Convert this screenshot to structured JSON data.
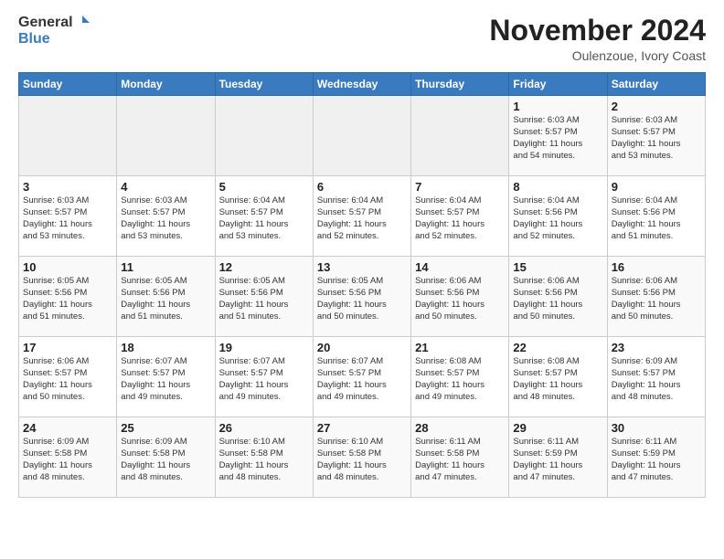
{
  "header": {
    "logo_general": "General",
    "logo_blue": "Blue",
    "month_title": "November 2024",
    "location": "Oulenzoue, Ivory Coast"
  },
  "days_of_week": [
    "Sunday",
    "Monday",
    "Tuesday",
    "Wednesday",
    "Thursday",
    "Friday",
    "Saturday"
  ],
  "weeks": [
    [
      {
        "day": "",
        "info": ""
      },
      {
        "day": "",
        "info": ""
      },
      {
        "day": "",
        "info": ""
      },
      {
        "day": "",
        "info": ""
      },
      {
        "day": "",
        "info": ""
      },
      {
        "day": "1",
        "info": "Sunrise: 6:03 AM\nSunset: 5:57 PM\nDaylight: 11 hours\nand 54 minutes."
      },
      {
        "day": "2",
        "info": "Sunrise: 6:03 AM\nSunset: 5:57 PM\nDaylight: 11 hours\nand 53 minutes."
      }
    ],
    [
      {
        "day": "3",
        "info": "Sunrise: 6:03 AM\nSunset: 5:57 PM\nDaylight: 11 hours\nand 53 minutes."
      },
      {
        "day": "4",
        "info": "Sunrise: 6:03 AM\nSunset: 5:57 PM\nDaylight: 11 hours\nand 53 minutes."
      },
      {
        "day": "5",
        "info": "Sunrise: 6:04 AM\nSunset: 5:57 PM\nDaylight: 11 hours\nand 53 minutes."
      },
      {
        "day": "6",
        "info": "Sunrise: 6:04 AM\nSunset: 5:57 PM\nDaylight: 11 hours\nand 52 minutes."
      },
      {
        "day": "7",
        "info": "Sunrise: 6:04 AM\nSunset: 5:57 PM\nDaylight: 11 hours\nand 52 minutes."
      },
      {
        "day": "8",
        "info": "Sunrise: 6:04 AM\nSunset: 5:56 PM\nDaylight: 11 hours\nand 52 minutes."
      },
      {
        "day": "9",
        "info": "Sunrise: 6:04 AM\nSunset: 5:56 PM\nDaylight: 11 hours\nand 51 minutes."
      }
    ],
    [
      {
        "day": "10",
        "info": "Sunrise: 6:05 AM\nSunset: 5:56 PM\nDaylight: 11 hours\nand 51 minutes."
      },
      {
        "day": "11",
        "info": "Sunrise: 6:05 AM\nSunset: 5:56 PM\nDaylight: 11 hours\nand 51 minutes."
      },
      {
        "day": "12",
        "info": "Sunrise: 6:05 AM\nSunset: 5:56 PM\nDaylight: 11 hours\nand 51 minutes."
      },
      {
        "day": "13",
        "info": "Sunrise: 6:05 AM\nSunset: 5:56 PM\nDaylight: 11 hours\nand 50 minutes."
      },
      {
        "day": "14",
        "info": "Sunrise: 6:06 AM\nSunset: 5:56 PM\nDaylight: 11 hours\nand 50 minutes."
      },
      {
        "day": "15",
        "info": "Sunrise: 6:06 AM\nSunset: 5:56 PM\nDaylight: 11 hours\nand 50 minutes."
      },
      {
        "day": "16",
        "info": "Sunrise: 6:06 AM\nSunset: 5:56 PM\nDaylight: 11 hours\nand 50 minutes."
      }
    ],
    [
      {
        "day": "17",
        "info": "Sunrise: 6:06 AM\nSunset: 5:57 PM\nDaylight: 11 hours\nand 50 minutes."
      },
      {
        "day": "18",
        "info": "Sunrise: 6:07 AM\nSunset: 5:57 PM\nDaylight: 11 hours\nand 49 minutes."
      },
      {
        "day": "19",
        "info": "Sunrise: 6:07 AM\nSunset: 5:57 PM\nDaylight: 11 hours\nand 49 minutes."
      },
      {
        "day": "20",
        "info": "Sunrise: 6:07 AM\nSunset: 5:57 PM\nDaylight: 11 hours\nand 49 minutes."
      },
      {
        "day": "21",
        "info": "Sunrise: 6:08 AM\nSunset: 5:57 PM\nDaylight: 11 hours\nand 49 minutes."
      },
      {
        "day": "22",
        "info": "Sunrise: 6:08 AM\nSunset: 5:57 PM\nDaylight: 11 hours\nand 48 minutes."
      },
      {
        "day": "23",
        "info": "Sunrise: 6:09 AM\nSunset: 5:57 PM\nDaylight: 11 hours\nand 48 minutes."
      }
    ],
    [
      {
        "day": "24",
        "info": "Sunrise: 6:09 AM\nSunset: 5:58 PM\nDaylight: 11 hours\nand 48 minutes."
      },
      {
        "day": "25",
        "info": "Sunrise: 6:09 AM\nSunset: 5:58 PM\nDaylight: 11 hours\nand 48 minutes."
      },
      {
        "day": "26",
        "info": "Sunrise: 6:10 AM\nSunset: 5:58 PM\nDaylight: 11 hours\nand 48 minutes."
      },
      {
        "day": "27",
        "info": "Sunrise: 6:10 AM\nSunset: 5:58 PM\nDaylight: 11 hours\nand 48 minutes."
      },
      {
        "day": "28",
        "info": "Sunrise: 6:11 AM\nSunset: 5:58 PM\nDaylight: 11 hours\nand 47 minutes."
      },
      {
        "day": "29",
        "info": "Sunrise: 6:11 AM\nSunset: 5:59 PM\nDaylight: 11 hours\nand 47 minutes."
      },
      {
        "day": "30",
        "info": "Sunrise: 6:11 AM\nSunset: 5:59 PM\nDaylight: 11 hours\nand 47 minutes."
      }
    ]
  ]
}
